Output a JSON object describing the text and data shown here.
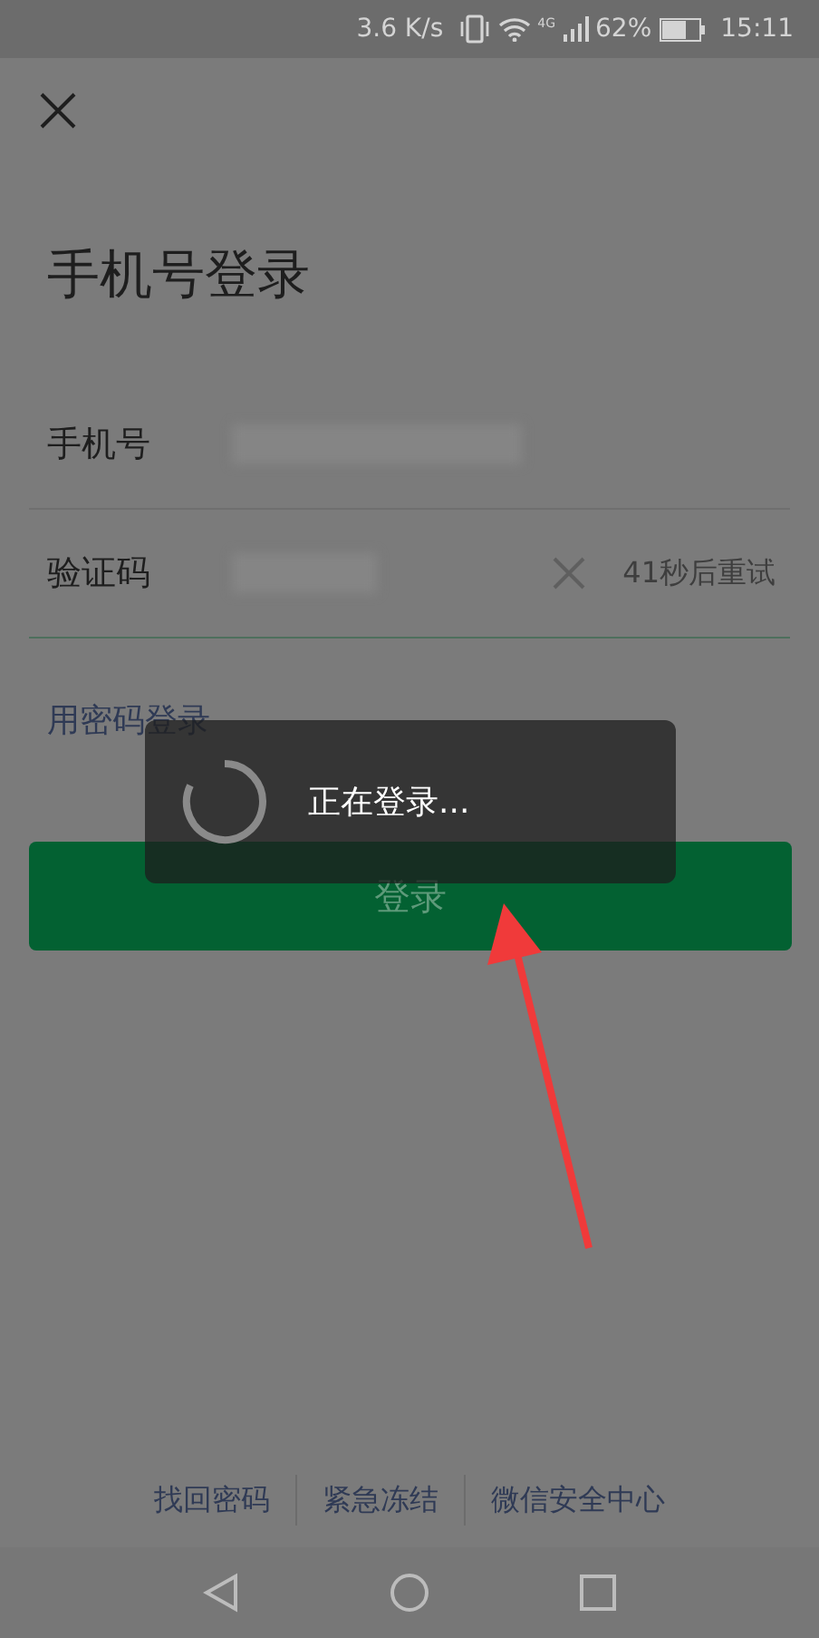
{
  "status_bar": {
    "speed": "3.6 K/s",
    "network": "4G",
    "battery": "62%",
    "time": "15:11"
  },
  "title": "手机号登录",
  "fields": [
    {
      "label": "手机号",
      "kind": "phone",
      "focused": false
    },
    {
      "label": "验证码",
      "kind": "code",
      "focused": true,
      "resend": "41秒后重试"
    }
  ],
  "password_login_link": "用密码登录",
  "login_button": "登录",
  "toast": {
    "text": "正在登录..."
  },
  "footer_links": [
    "找回密码",
    "紧急冻结",
    "微信安全中心"
  ]
}
